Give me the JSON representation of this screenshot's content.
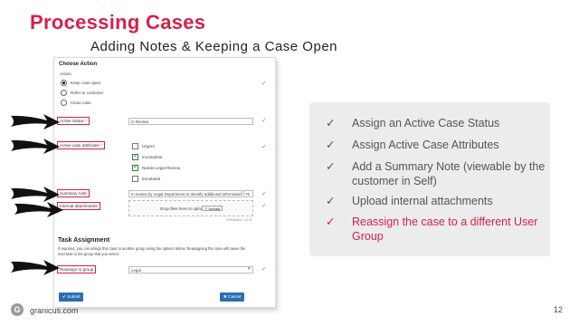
{
  "slide": {
    "title": "Processing Cases",
    "subtitle": "Adding Notes & Keeping a Case Open",
    "brand": "granicus.com",
    "brand_icon": "G",
    "page_number": "12",
    "accent_color": "#d81f4a"
  },
  "form": {
    "heading": "Choose Action",
    "action_label": "Action",
    "options": [
      {
        "label": "Keep case open",
        "selected": true
      },
      {
        "label": "Refer to customer",
        "selected": false
      },
      {
        "label": "Close case",
        "selected": false
      }
    ],
    "active_status": {
      "label": "Active Status",
      "required": "*",
      "value": "In Review"
    },
    "attributes": {
      "label": "Active case attributes",
      "required": "*",
      "items": [
        {
          "label": "Urgent",
          "checked": false
        },
        {
          "label": "Incomplete",
          "checked": true
        },
        {
          "label": "Needs Legal Review",
          "checked": true
        },
        {
          "label": "Escalated",
          "checked": false
        }
      ]
    },
    "summary": {
      "label": "Summary note",
      "value": "In review by Legal Department to identify additional information",
      "counter": "76"
    },
    "attachments": {
      "label": "Internal attachments",
      "drop_text": "Drop files here to upload",
      "upload_button": "Upload",
      "size_note": "0/20480/0 / 10 B"
    },
    "task_assignment": {
      "heading": "Task Assignment",
      "description_line1": "If required, you can assign this case to another group using the options below. Reassigning the case will cause the",
      "description_line2": "next task to the group that you select.",
      "reassign_label": "Reassign to group",
      "reassign_value": "Legal"
    },
    "submit_label": "Submit",
    "cancel_label": "Cancel"
  },
  "checklist": [
    {
      "check": "✓",
      "text": "Assign an Active Case Status",
      "highlight": false
    },
    {
      "check": "✓",
      "text": "Assign Active Case Attributes",
      "highlight": false
    },
    {
      "check": "✓",
      "text": "Add a Summary Note (viewable by the customer in Self)",
      "highlight": false
    },
    {
      "check": "✓",
      "text": "Upload internal attachments",
      "highlight": false
    },
    {
      "check": "✓",
      "text": "Reassign the case to a different User Group",
      "highlight": true
    }
  ]
}
